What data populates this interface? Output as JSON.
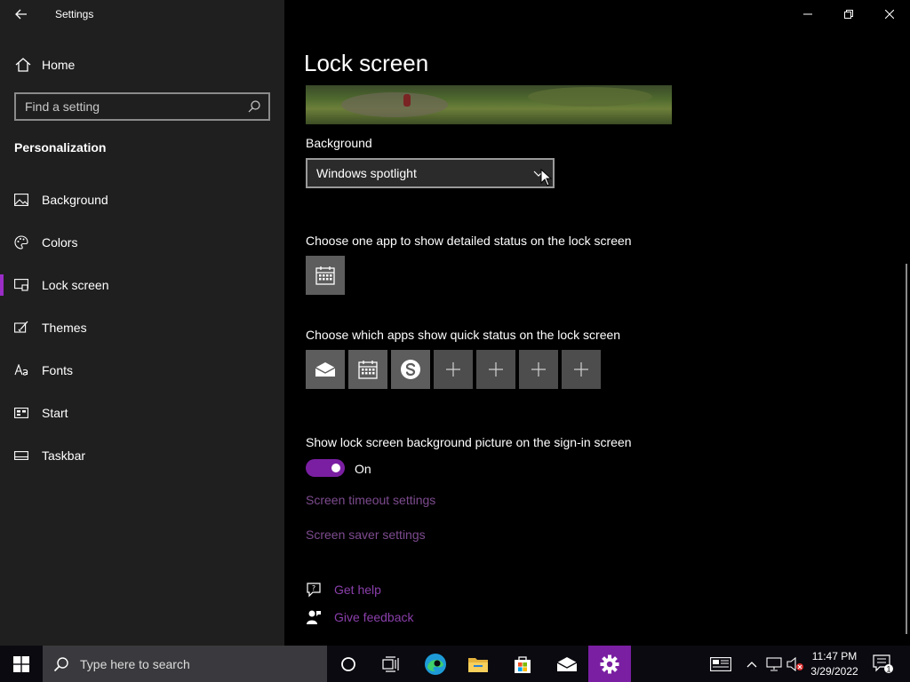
{
  "window": {
    "title": "Settings"
  },
  "sidebar": {
    "home_label": "Home",
    "search_placeholder": "Find a setting",
    "section_title": "Personalization",
    "items": [
      {
        "label": "Background",
        "icon": "image-icon",
        "selected": false
      },
      {
        "label": "Colors",
        "icon": "palette-icon",
        "selected": false
      },
      {
        "label": "Lock screen",
        "icon": "lock-screen-icon",
        "selected": true
      },
      {
        "label": "Themes",
        "icon": "brush-icon",
        "selected": false
      },
      {
        "label": "Fonts",
        "icon": "font-icon",
        "selected": false
      },
      {
        "label": "Start",
        "icon": "start-icon",
        "selected": false
      },
      {
        "label": "Taskbar",
        "icon": "taskbar-icon",
        "selected": false
      }
    ]
  },
  "main": {
    "title": "Lock screen",
    "background_label": "Background",
    "background_value": "Windows spotlight",
    "detailed_status_label": "Choose one app to show detailed status on the lock screen",
    "detailed_status_app": "calendar-icon",
    "quick_status_label": "Choose which apps show quick status on the lock screen",
    "quick_status_apps": [
      "mail-icon",
      "calendar-icon",
      "skype-icon",
      "plus-icon",
      "plus-icon",
      "plus-icon",
      "plus-icon"
    ],
    "signin_label": "Show lock screen background picture on the sign-in screen",
    "signin_toggle": "On",
    "signin_toggle_on": true,
    "link_timeout": "Screen timeout settings",
    "link_saver": "Screen saver settings",
    "get_help": "Get help",
    "give_feedback": "Give feedback"
  },
  "taskbar": {
    "search_placeholder": "Type here to search",
    "apps": [
      "cortana-icon",
      "task-view-icon",
      "edge-icon",
      "file-explorer-icon",
      "store-icon",
      "mail-icon",
      "settings-icon"
    ],
    "active_app": "settings-icon",
    "time": "11:47 PM",
    "date": "3/29/2022",
    "notification_count": "1"
  },
  "colors": {
    "accent": "#7a1fa2",
    "link": "#7d4b8f",
    "sidebar_bg": "#1f1f1f",
    "main_bg": "#000000"
  }
}
